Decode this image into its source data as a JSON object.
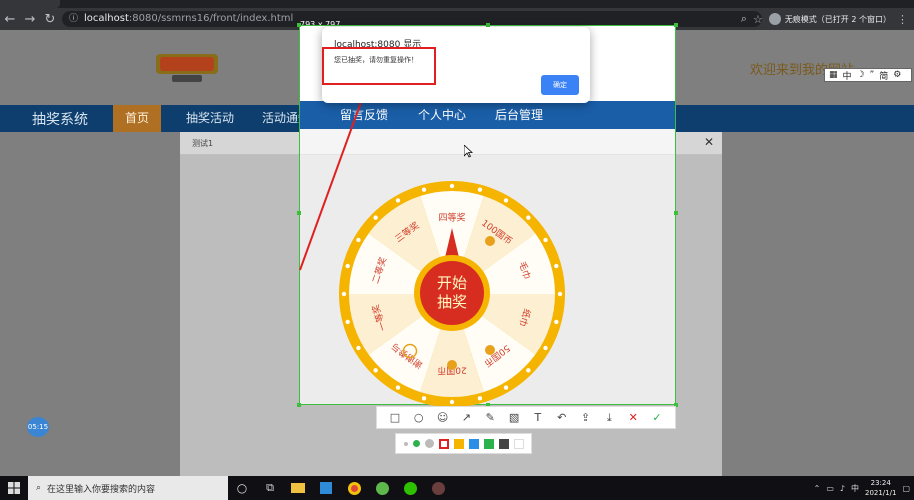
{
  "browser": {
    "url_host": "localhost",
    "url_path": ":8080/ssmrns16/front/index.html",
    "incognito_label": "无痕模式（已打开 2 个窗口）"
  },
  "selection_size": "793 x 797",
  "site": {
    "welcome": "欢迎来到我的网站",
    "brand": "抽奖系统",
    "nav": [
      "首页",
      "抽奖活动",
      "活动通知",
      "留言反馈",
      "个人中心",
      "后台管理"
    ],
    "ime": [
      "中",
      "简"
    ]
  },
  "modal": {
    "title": "测试1",
    "close": "✕"
  },
  "wheel": {
    "center_line1": "开始",
    "center_line2": "抽奖",
    "segments": [
      "四等奖",
      "100国币",
      "毛巾",
      "纸巾",
      "50国币",
      "20国币",
      "谢谢参与",
      "一等奖",
      "二等奖",
      "三等奖"
    ]
  },
  "alert": {
    "title": "localhost:8080 显示",
    "message": "您已抽奖，请勿重复操作！",
    "ok": "确定"
  },
  "timer": "05:15",
  "taskbar": {
    "search_placeholder": "在这里输入你要搜索的内容",
    "time": "23:24",
    "date": "2021/1/1",
    "lang": "中"
  },
  "colors": {
    "accent": "#e02020",
    "nav_blue": "#1a5ea8",
    "gold": "#f5b400",
    "wheel_red": "#d62d20"
  }
}
